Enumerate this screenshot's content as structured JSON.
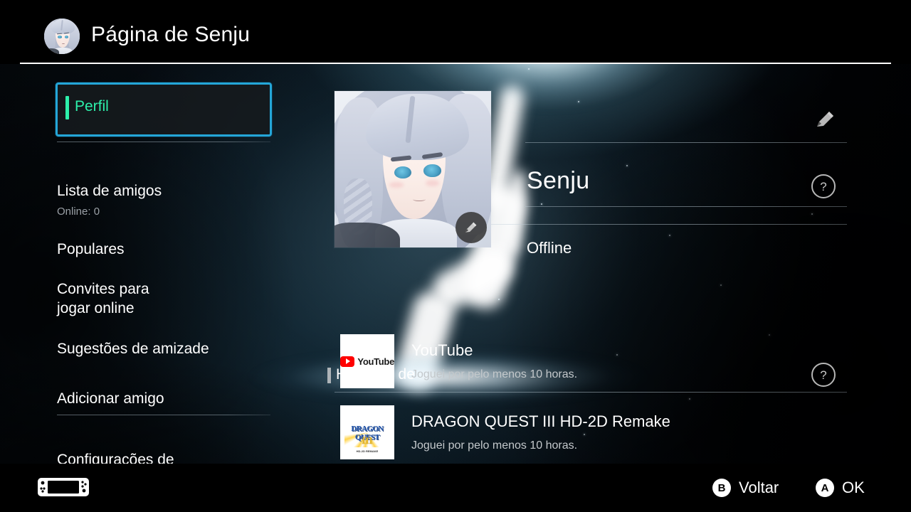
{
  "header": {
    "title": "Página de Senju",
    "avatar_icon": "user-avatar-image"
  },
  "sidebar": {
    "items": [
      {
        "label": "Perfil",
        "sub": "",
        "selected": true
      },
      {
        "label": "Lista de amigos",
        "sub": "Online: 0",
        "selected": false
      },
      {
        "label": "Populares",
        "sub": "",
        "selected": false
      },
      {
        "label": "Convites para\njogar online",
        "sub": "",
        "selected": false
      },
      {
        "label": "Sugestões de amizade",
        "sub": "",
        "selected": false
      },
      {
        "label": "Adicionar amigo",
        "sub": "",
        "selected": false
      },
      {
        "label": "Configurações de\nusuário",
        "sub": "",
        "selected": false
      }
    ]
  },
  "profile": {
    "avatar_icon": "profile-avatar-image",
    "avatar_edit_icon": "pencil-icon",
    "name": "Senju",
    "name_edit_icon": "pencil-icon",
    "status": "Offline",
    "status_help_icon": "question-mark-icon"
  },
  "history": {
    "section_title": "Histórico de",
    "help_icon": "question-mark-icon",
    "entries": [
      {
        "title": "YouTube",
        "subtitle": "Joguei por pelo menos 10 horas.",
        "thumb_icon": "youtube-logo"
      },
      {
        "title": "DRAGON QUEST III HD-2D Remake",
        "subtitle": "Joguei por pelo menos 10 horas.",
        "thumb_icon": "dragon-quest-logo",
        "thumb_word": "DRAGON QUEST",
        "thumb_numeral": "III",
        "thumb_tagline": "HD-2D REMAKE"
      }
    ]
  },
  "footer": {
    "console_icon": "switch-handheld-icon",
    "hints": [
      {
        "glyph": "B",
        "label": "Voltar"
      },
      {
        "glyph": "A",
        "label": "OK"
      }
    ]
  },
  "colors": {
    "selection_border": "#24a6d8",
    "selection_accent": "#2df0ab",
    "background": "#000009",
    "text": "#ffffff",
    "muted_text": "#9aa0a6"
  }
}
